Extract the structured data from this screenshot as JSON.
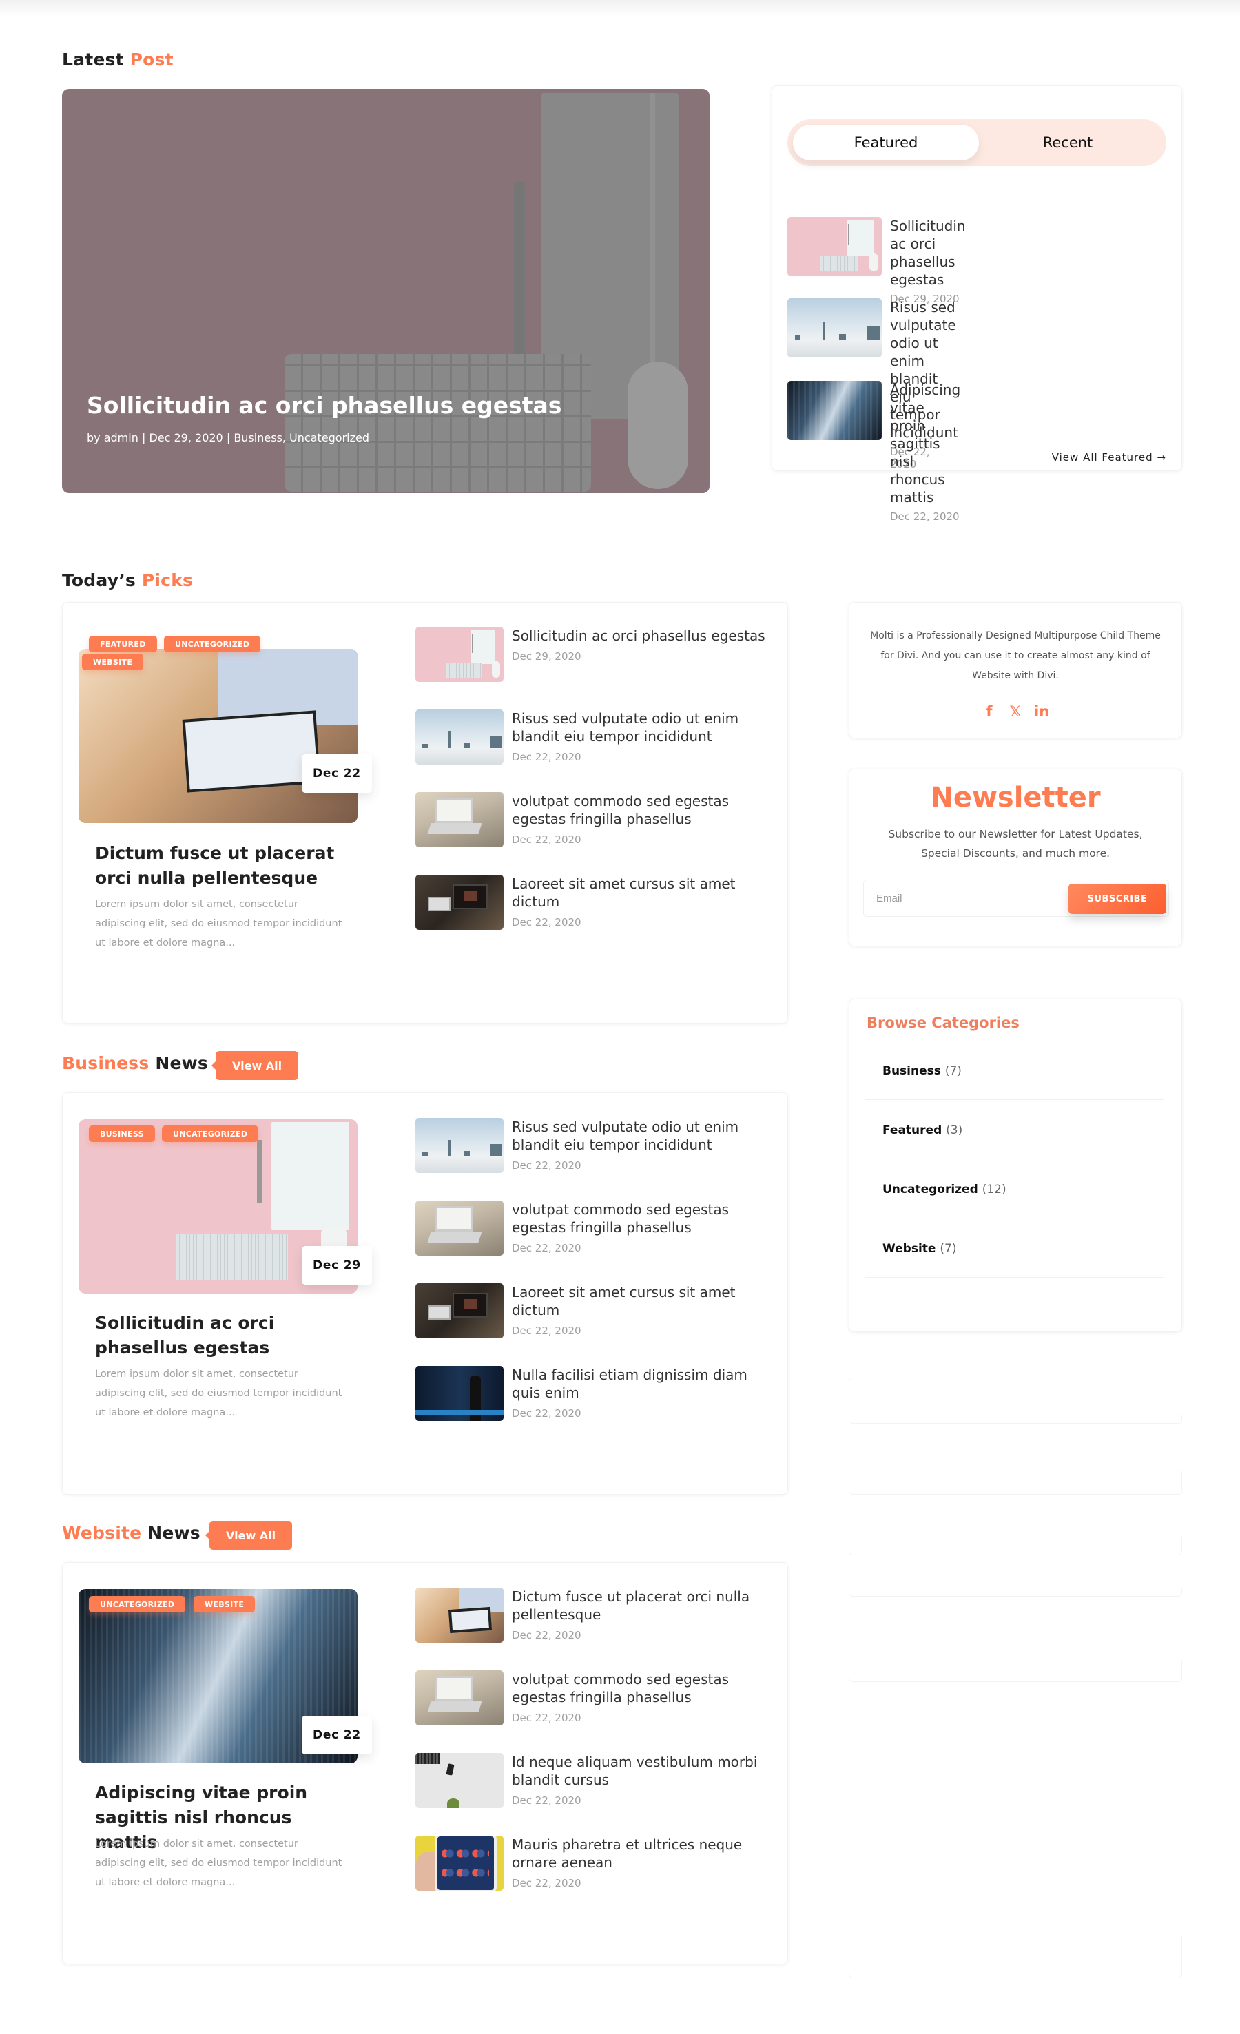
{
  "colors": {
    "accent": "#fe7c51",
    "tab_bg": "#fde9e1"
  },
  "latest": {
    "heading_plain": "Latest",
    "heading_accent": "Post",
    "hero": {
      "title": "Sollicitudin ac orci phasellus egestas",
      "meta_prefix": "by",
      "author": "admin",
      "date": "Dec 29, 2020",
      "categories": [
        "Business",
        "Uncategorized"
      ],
      "separator": "|"
    }
  },
  "tabs_widget": {
    "tabs": [
      {
        "label": "Featured",
        "active": true
      },
      {
        "label": "Recent",
        "active": false
      }
    ],
    "items": [
      {
        "title": "Sollicitudin ac orci phasellus egestas",
        "date": "Dec 29, 2020",
        "thumb": "desk"
      },
      {
        "title": "Risus sed vulputate odio ut enim blandit eiu tempor incididunt",
        "date": "Dec 22, 2020",
        "thumb": "fog"
      },
      {
        "title": "Adipiscing vitae proin sagittis nisl rhoncus mattis",
        "date": "Dec 22, 2020",
        "thumb": "tower"
      }
    ],
    "view_all_label": "View All Featured",
    "view_all_icon": "→"
  },
  "todays_picks": {
    "heading_plain": "Today’s",
    "heading_accent": "Picks",
    "featured": {
      "tags": [
        "FEATURED",
        "UNCATEGORIZED",
        "WEBSITE"
      ],
      "date_badge": "Dec 22",
      "title": "Dictum fusce ut placerat orci nulla pellentesque",
      "excerpt": "Lorem ipsum dolor sit amet, consectetur adipiscing elit, sed do eiusmod tempor incididunt ut labore et dolore magna...",
      "thumb": "tablet"
    },
    "list": [
      {
        "title": "Sollicitudin ac orci phasellus egestas",
        "date": "Dec 29, 2020",
        "thumb": "desk"
      },
      {
        "title": "Risus sed vulputate odio ut enim blandit eiu tempor incididunt",
        "date": "Dec 22, 2020",
        "thumb": "fog"
      },
      {
        "title": "volutpat commodo sed egestas egestas fringilla phasellus",
        "date": "Dec 22, 2020",
        "thumb": "laptop"
      },
      {
        "title": "Laoreet sit amet cursus sit amet dictum",
        "date": "Dec 22, 2020",
        "thumb": "dark"
      }
    ]
  },
  "business_news": {
    "heading_accent": "Business",
    "heading_plain": "News",
    "view_all_label": "View All",
    "featured": {
      "tags": [
        "BUSINESS",
        "UNCATEGORIZED"
      ],
      "date_badge": "Dec 29",
      "title": "Sollicitudin ac orci phasellus egestas",
      "excerpt": "Lorem ipsum dolor sit amet, consectetur adipiscing elit, sed do eiusmod tempor incididunt ut labore et dolore magna...",
      "thumb": "desk"
    },
    "list": [
      {
        "title": "Risus sed vulputate odio ut enim blandit eiu tempor incididunt",
        "date": "Dec 22, 2020",
        "thumb": "fog"
      },
      {
        "title": "volutpat commodo sed egestas egestas fringilla phasellus",
        "date": "Dec 22, 2020",
        "thumb": "laptop"
      },
      {
        "title": "Laoreet sit amet cursus sit amet dictum",
        "date": "Dec 22, 2020",
        "thumb": "dark"
      },
      {
        "title": "Nulla facilisi etiam dignissim diam quis enim",
        "date": "Dec 22, 2020",
        "thumb": "server"
      }
    ]
  },
  "website_news": {
    "heading_accent": "Website",
    "heading_plain": "News",
    "view_all_label": "View All",
    "featured": {
      "tags": [
        "UNCATEGORIZED",
        "WEBSITE"
      ],
      "date_badge": "Dec 22",
      "title": "Adipiscing vitae proin sagittis nisl rhoncus mattis",
      "excerpt": "Lorem ipsum dolor sit amet, consectetur adipiscing elit, sed do eiusmod tempor incididunt ut labore et dolore magna...",
      "thumb": "tower"
    },
    "list": [
      {
        "title": "Dictum fusce ut placerat orci nulla pellentesque",
        "date": "Dec 22, 2020",
        "thumb": "tablet"
      },
      {
        "title": "volutpat commodo sed egestas egestas fringilla phasellus",
        "date": "Dec 22, 2020",
        "thumb": "laptop"
      },
      {
        "title": "Id neque aliquam vestibulum morbi blandit cursus",
        "date": "Dec 22, 2020",
        "thumb": "white"
      },
      {
        "title": "Mauris pharetra et ultrices neque ornare aenean",
        "date": "Dec 22, 2020",
        "thumb": "phone"
      }
    ]
  },
  "sidebar": {
    "about": {
      "text": "Molti is a Professionally Designed Multipurpose Child Theme for Divi. And you can use it to create almost any kind of Website with Divi.",
      "social": [
        {
          "name": "facebook-icon",
          "glyph": "f"
        },
        {
          "name": "x-twitter-icon",
          "glyph": "𝕏"
        },
        {
          "name": "linkedin-icon",
          "glyph": "in"
        }
      ]
    },
    "newsletter": {
      "title": "Newsletter",
      "subtitle": "Subscribe to our Newsletter for Latest Updates, Special Discounts, and much more.",
      "email_placeholder": "Email",
      "email_value": "",
      "subscribe_label": "SUBSCRIBE"
    },
    "categories": {
      "title": "Browse Categories",
      "items": [
        {
          "name": "Business",
          "count": "(7)"
        },
        {
          "name": "Featured",
          "count": "(3)"
        },
        {
          "name": "Uncategorized",
          "count": "(12)"
        },
        {
          "name": "Website",
          "count": "(7)"
        }
      ]
    }
  }
}
